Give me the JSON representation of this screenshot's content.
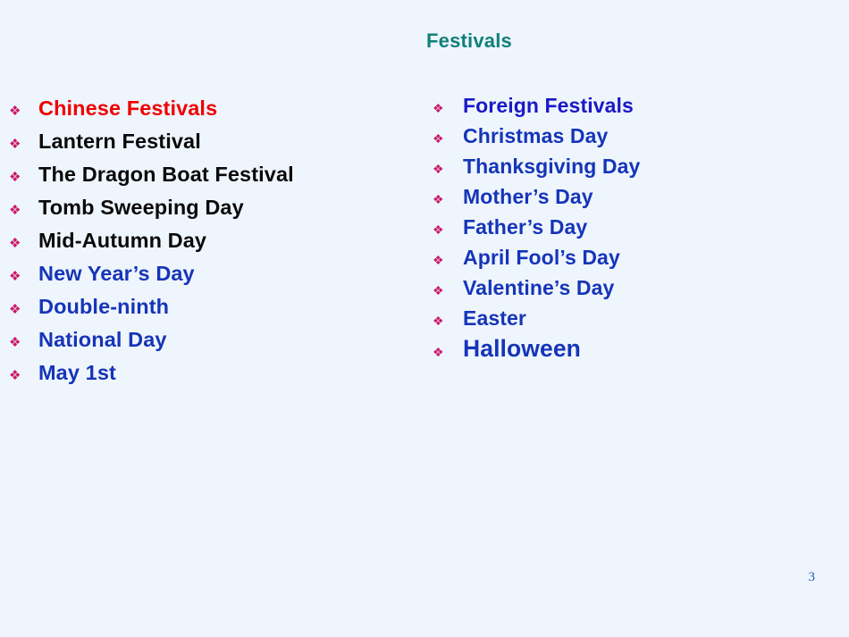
{
  "slide": {
    "title": "Festivals",
    "title_color": "#10807a",
    "background_color": "#eff5fd",
    "bullet_glyph": "❖",
    "bullet_color": "#c8186b",
    "page_number": "3"
  },
  "left_column": {
    "items": [
      {
        "label": "Chinese Festivals",
        "color": "#ee0000"
      },
      {
        "label": "Lantern Festival",
        "color": "#0a0a0a"
      },
      {
        "label": "The Dragon Boat Festival",
        "color": "#0a0a0a"
      },
      {
        "label": "Tomb Sweeping Day",
        "color": "#0a0a0a"
      },
      {
        "label": "Mid-Autumn Day",
        "color": "#0a0a0a"
      },
      {
        "label": "New Year’s Day",
        "color": "#1535b8"
      },
      {
        "label": "Double-ninth",
        "color": "#1535b8"
      },
      {
        "label": "National Day",
        "color": "#1535b8"
      },
      {
        "label": "May 1st",
        "color": "#1535b8"
      }
    ]
  },
  "right_column": {
    "items": [
      {
        "label": "Foreign Festivals",
        "color": "#1a19c6"
      },
      {
        "label": "Christmas Day",
        "color": "#1535b8"
      },
      {
        "label": "Thanksgiving Day",
        "color": "#1535b8"
      },
      {
        "label": "Mother’s Day",
        "color": "#1535b8"
      },
      {
        "label": "Father’s Day",
        "color": "#1535b8"
      },
      {
        "label": "April Fool’s Day",
        "color": "#1535b8"
      },
      {
        "label": "Valentine’s Day",
        "color": "#1535b8"
      },
      {
        "label": "Easter",
        "color": "#1535b8"
      },
      {
        "label": "Halloween",
        "color": "#1535b8"
      }
    ]
  }
}
